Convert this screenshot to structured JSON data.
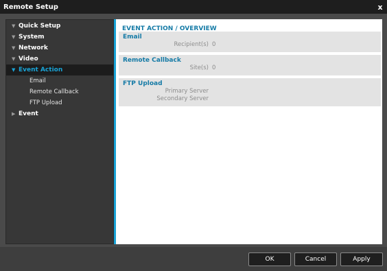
{
  "window": {
    "title": "Remote Setup",
    "close_glyph": "x"
  },
  "sidebar": {
    "items": [
      {
        "label": "Quick Setup",
        "expander": "▼"
      },
      {
        "label": "System",
        "expander": "▼"
      },
      {
        "label": "Network",
        "expander": "▼"
      },
      {
        "label": "Video",
        "expander": "▼"
      },
      {
        "label": "Event Action",
        "expander": "▼",
        "active": true,
        "children": [
          "Email",
          "Remote Callback",
          "FTP Upload"
        ]
      },
      {
        "label": "Event",
        "expander": "▶"
      }
    ]
  },
  "main": {
    "title": "EVENT ACTION / OVERVIEW",
    "sections": [
      {
        "title": "Email",
        "rows": [
          {
            "label": "Recipient(s)",
            "value": "0"
          }
        ]
      },
      {
        "title": "Remote Callback",
        "rows": [
          {
            "label": "Site(s)",
            "value": "0"
          }
        ]
      },
      {
        "title": "FTP Upload",
        "rows": [
          {
            "label": "Primary Server",
            "value": ""
          },
          {
            "label": "Secondary Server",
            "value": ""
          }
        ]
      }
    ]
  },
  "buttons": {
    "ok": "OK",
    "cancel": "Cancel",
    "apply": "Apply"
  },
  "colors": {
    "accent": "#19a3d6",
    "heading": "#147aa6"
  }
}
